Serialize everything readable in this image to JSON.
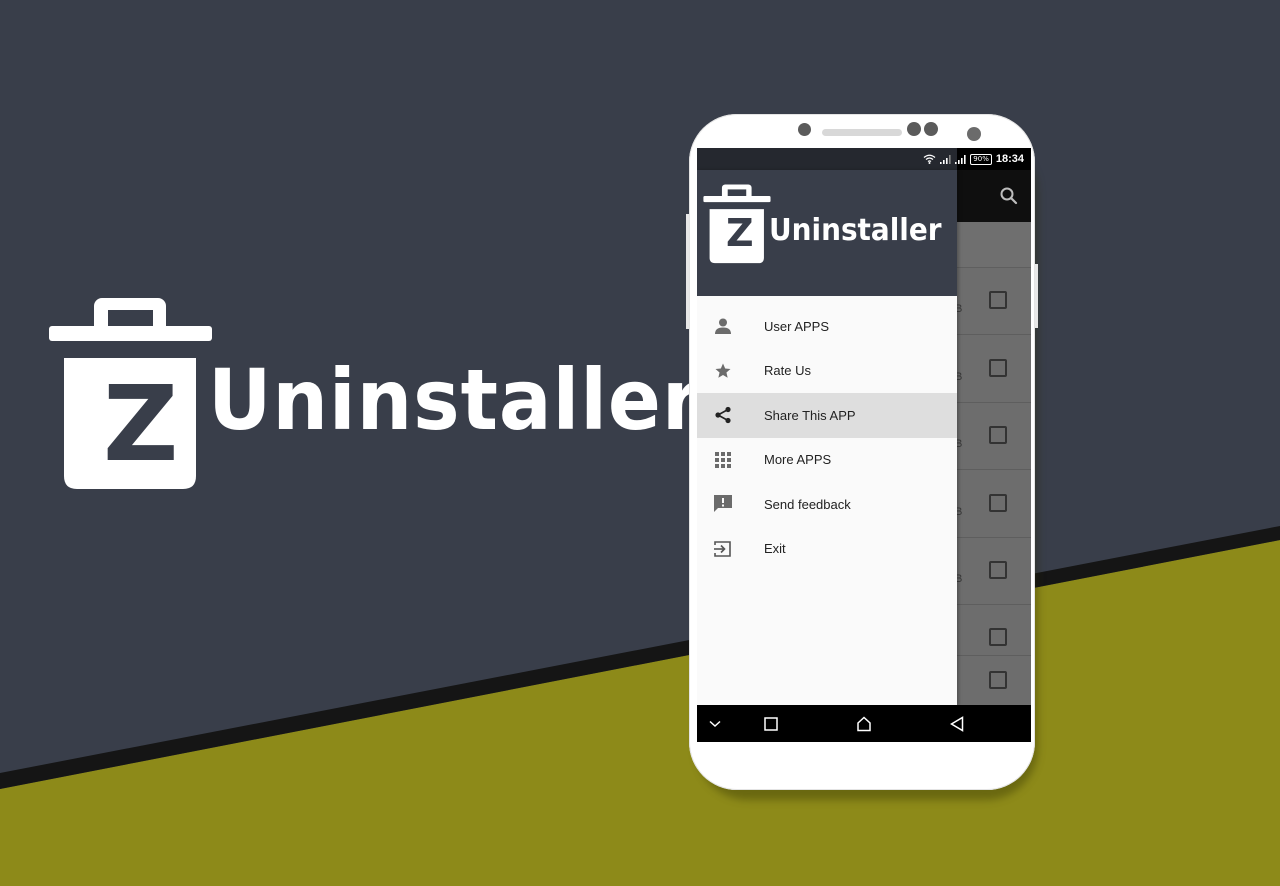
{
  "brand": {
    "app_name": "Uninstaller",
    "logo_letter": "Z",
    "colors": {
      "slate": "#393e4a",
      "olive": "#8d8a19",
      "band": "#151515",
      "white": "#ffffff",
      "drawer_bg": "#fafafa",
      "active_item_bg": "#dedede",
      "icon_gray": "#6b6b6b"
    }
  },
  "phone": {
    "status_bar": {
      "icons": [
        "wifi-icon",
        "signal-icon",
        "signal-icon",
        "battery-icon"
      ],
      "battery_label": "90%",
      "time": "18:34"
    },
    "app_bar": {
      "action_icon": "search-icon"
    },
    "drawer": {
      "header_logo_letter": "Z",
      "header_title": "Uninstaller",
      "items": [
        {
          "label": "User APPS",
          "icon": "person-icon",
          "active": false
        },
        {
          "label": "Rate Us",
          "icon": "star-icon",
          "active": false
        },
        {
          "label": "Share This APP",
          "icon": "share-icon",
          "active": true
        },
        {
          "label": "More APPS",
          "icon": "apps-grid-icon",
          "active": false
        },
        {
          "label": "Send feedback",
          "icon": "feedback-icon",
          "active": false
        },
        {
          "label": "Exit",
          "icon": "exit-icon",
          "active": false
        }
      ]
    },
    "app_list": {
      "rows": [
        {
          "size_suffix": "B",
          "checked": false
        },
        {
          "size_suffix": "B",
          "checked": false
        },
        {
          "size_suffix": "B",
          "checked": false
        },
        {
          "size_suffix": "B",
          "checked": false
        },
        {
          "size_suffix": "B",
          "checked": false
        },
        {
          "size_suffix": "",
          "checked": false
        },
        {
          "size_suffix": "",
          "checked": false
        }
      ]
    },
    "nav_bar": {
      "buttons": [
        "hide-nav-icon",
        "recents-icon",
        "home-icon",
        "back-icon"
      ]
    }
  }
}
